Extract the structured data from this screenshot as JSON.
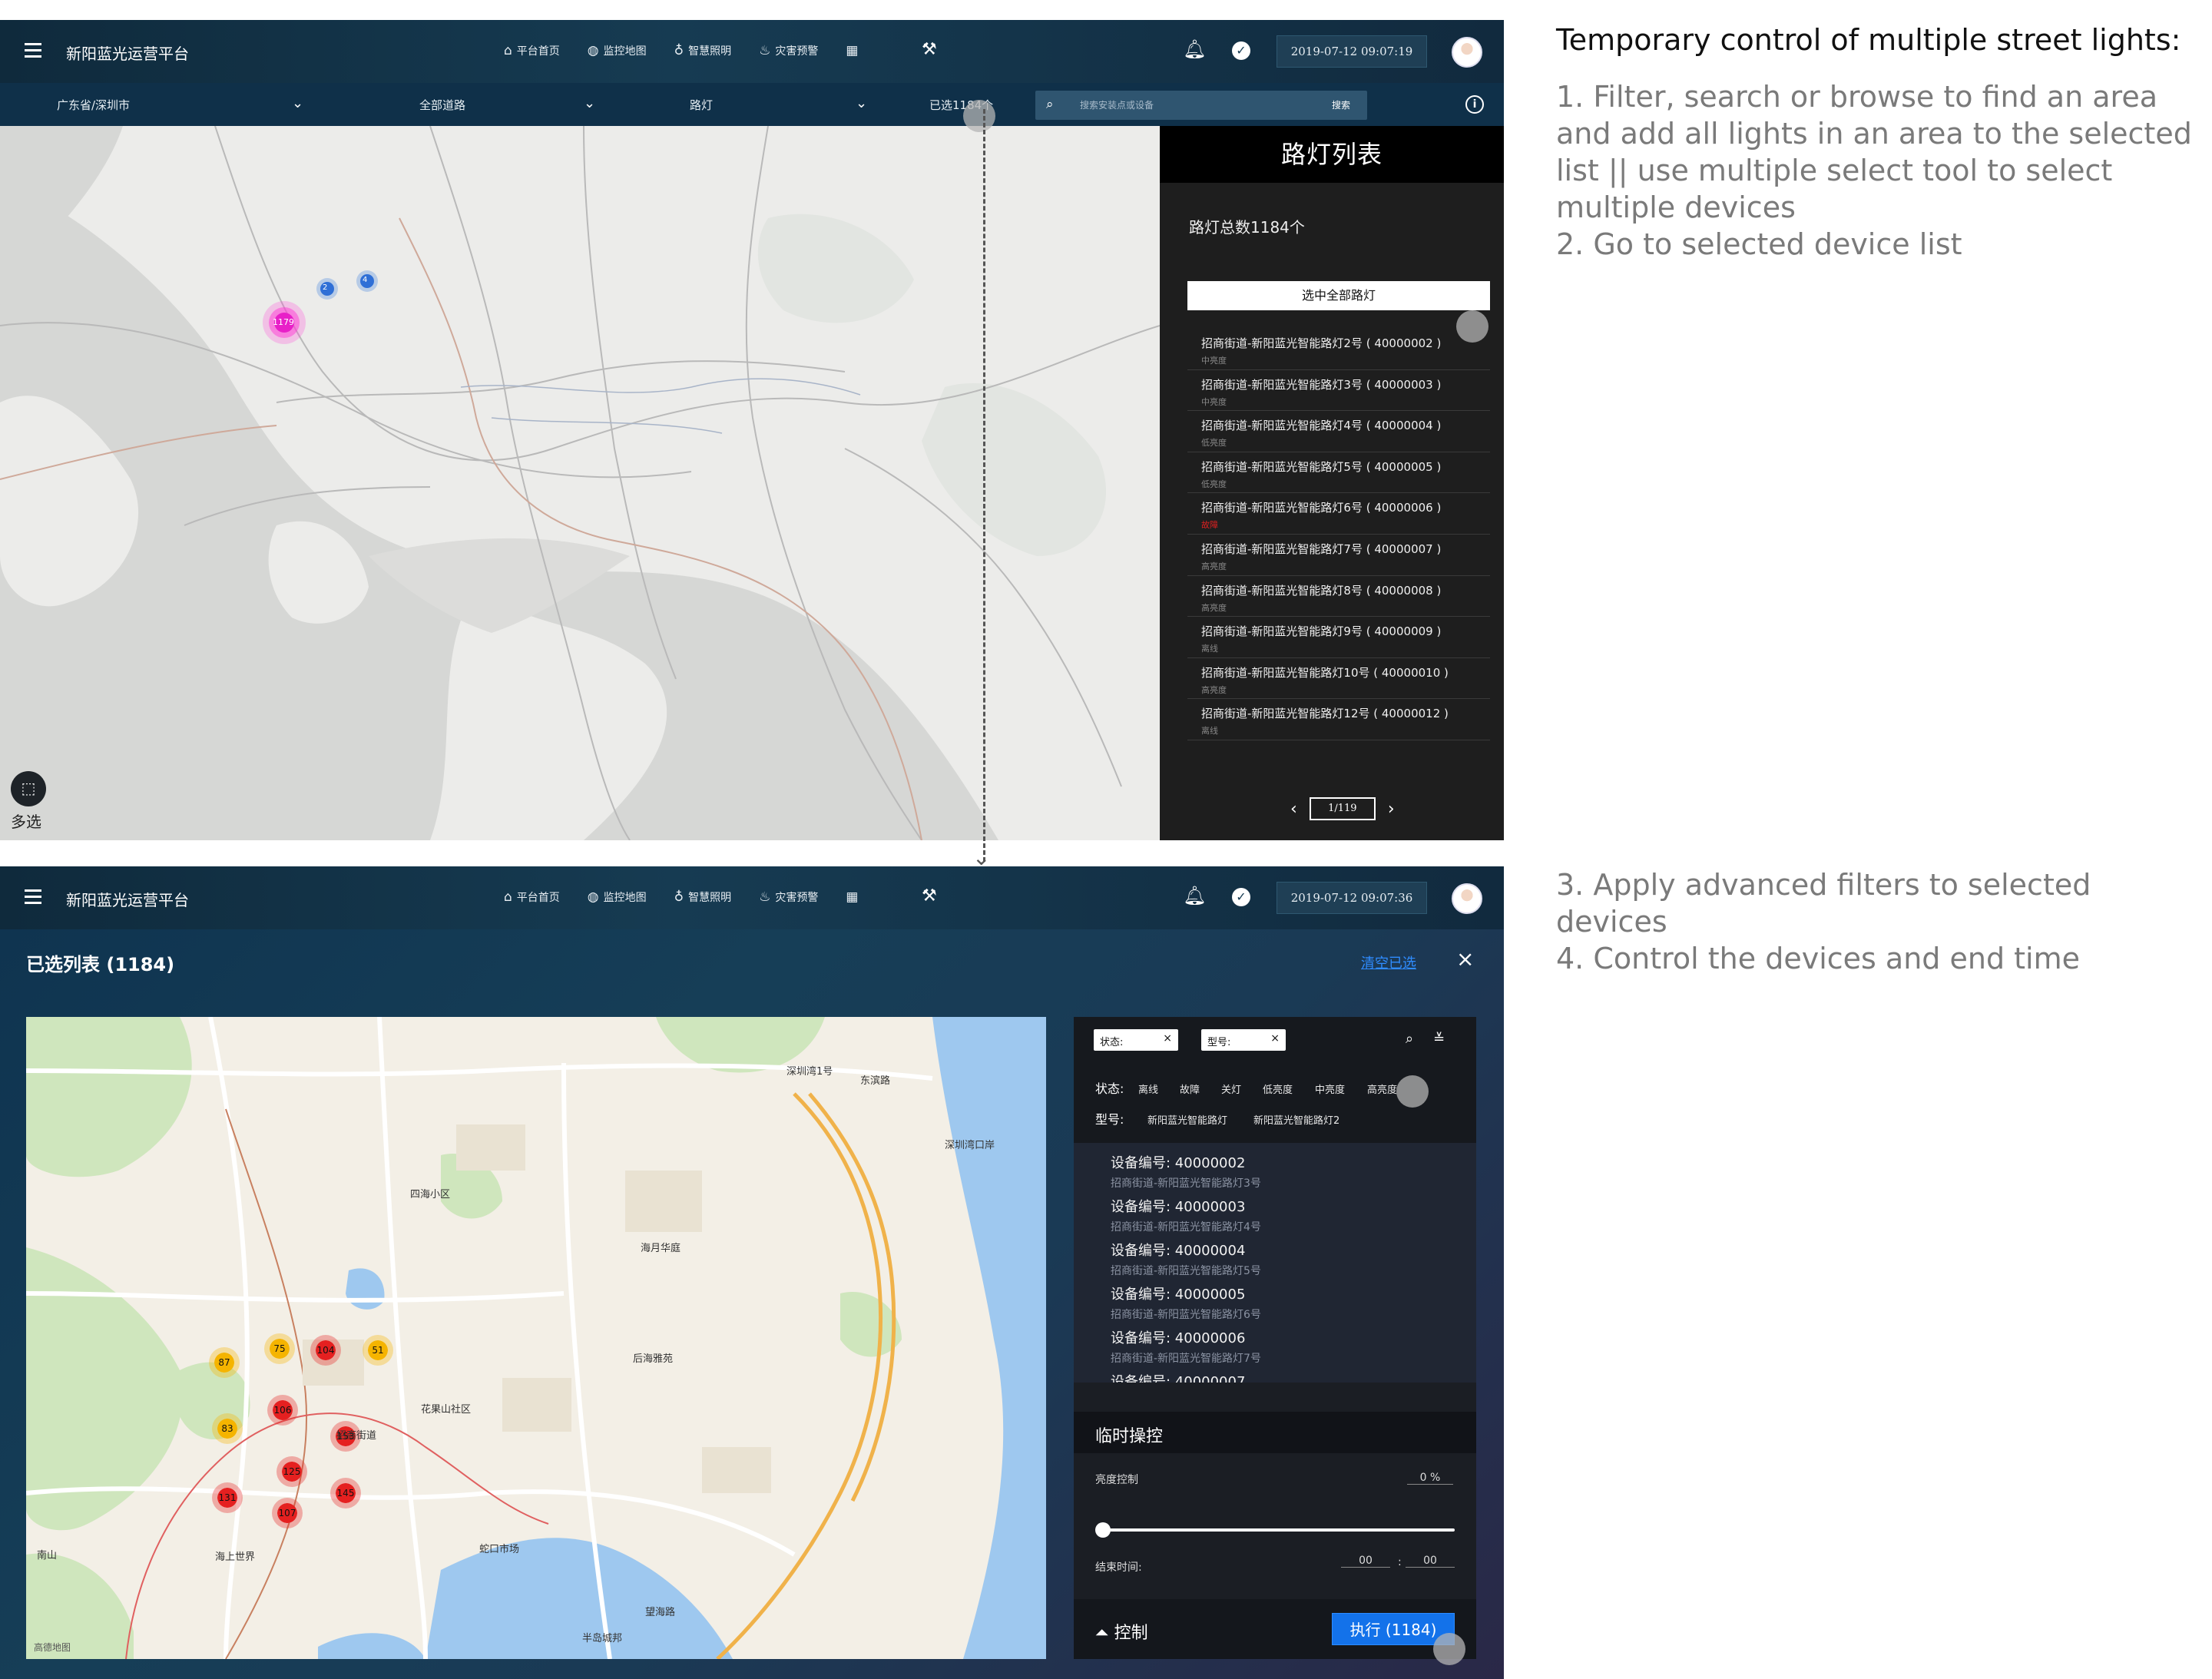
{
  "screen1": {
    "app_title": "新阳蓝光运营平台",
    "nav": [
      {
        "icon": "home-icon",
        "label": "平台首页"
      },
      {
        "icon": "globe-icon",
        "label": "监控地图"
      },
      {
        "icon": "bulb-icon",
        "label": "智慧照明"
      },
      {
        "icon": "alert-icon",
        "label": "灾害预警"
      }
    ],
    "datetime": "2019-07-12 09:07:19",
    "filter": {
      "region": "广东省/深圳市",
      "road": "全部道路",
      "device_type": "路灯",
      "selected": "已选1184个",
      "search_placeholder": "搜索安装点或设备",
      "search_button": "搜索"
    },
    "map": {
      "clusters": [
        "2",
        "4",
        "1179"
      ],
      "multi_select_label": "多选"
    },
    "side_list": {
      "title": "路灯列表",
      "total": "路灯总数1184个",
      "select_all_button": "选中全部路灯",
      "items": [
        {
          "name": "招商街道-新阳蓝光智能路灯2号 ( 40000002 )",
          "status": "中亮度"
        },
        {
          "name": "招商街道-新阳蓝光智能路灯3号 ( 40000003 )",
          "status": "中亮度"
        },
        {
          "name": "招商街道-新阳蓝光智能路灯4号 ( 40000004 )",
          "status": "低亮度"
        },
        {
          "name": "招商街道-新阳蓝光智能路灯5号 ( 40000005 )",
          "status": "低亮度"
        },
        {
          "name": "招商街道-新阳蓝光智能路灯6号 ( 40000006 )",
          "status": "故障"
        },
        {
          "name": "招商街道-新阳蓝光智能路灯7号 ( 40000007 )",
          "status": "高亮度"
        },
        {
          "name": "招商街道-新阳蓝光智能路灯8号 ( 40000008 )",
          "status": "高亮度"
        },
        {
          "name": "招商街道-新阳蓝光智能路灯9号 ( 40000009 )",
          "status": "离线"
        },
        {
          "name": "招商街道-新阳蓝光智能路灯10号 ( 40000010 )",
          "status": "高亮度"
        },
        {
          "name": "招商街道-新阳蓝光智能路灯12号 ( 40000012 )",
          "status": "离线"
        }
      ],
      "pager": "1/119"
    }
  },
  "screen2": {
    "app_title": "新阳蓝光运营平台",
    "datetime": "2019-07-12 09:07:36",
    "page_title": "已选列表 (1184)",
    "clear_link": "清空已选",
    "map": {
      "clusters": [
        {
          "label": "87",
          "color": "#f5b400"
        },
        {
          "label": "75",
          "color": "#f5b400"
        },
        {
          "label": "104",
          "color": "#e52020"
        },
        {
          "label": "51",
          "color": "#f5b400"
        },
        {
          "label": "106",
          "color": "#e52020"
        },
        {
          "label": "83",
          "color": "#f5b400"
        },
        {
          "label": "153",
          "color": "#e52020"
        },
        {
          "label": "125",
          "color": "#e52020"
        },
        {
          "label": "131",
          "color": "#e52020"
        },
        {
          "label": "107",
          "color": "#e52020"
        },
        {
          "label": "145",
          "color": "#e52020"
        }
      ],
      "places": [
        "南山",
        "海上世界",
        "半岛城邦",
        "深圳湾1号",
        "蛇口市场",
        "花果山社区",
        "东滨路",
        "深圳湾口岸",
        "海月华庭",
        "招商街道",
        "后海雅苑",
        "四海小区",
        "望海路",
        "高德地图"
      ]
    },
    "filters": {
      "chip_status": "状态:",
      "chip_model": "型号:",
      "status_label": "状态:",
      "status_options": [
        "离线",
        "故障",
        "关灯",
        "低亮度",
        "中亮度",
        "高亮度"
      ],
      "model_label": "型号:",
      "model_options": [
        "新阳蓝光智能路灯",
        "新阳蓝光智能路灯2"
      ]
    },
    "devices": [
      {
        "code": "设备编号: 40000002",
        "name": "招商街道-新阳蓝光智能路灯3号"
      },
      {
        "code": "设备编号: 40000003",
        "name": "招商街道-新阳蓝光智能路灯4号"
      },
      {
        "code": "设备编号: 40000004",
        "name": "招商街道-新阳蓝光智能路灯5号"
      },
      {
        "code": "设备编号: 40000005",
        "name": "招商街道-新阳蓝光智能路灯6号"
      },
      {
        "code": "设备编号: 40000006",
        "name": "招商街道-新阳蓝光智能路灯7号"
      },
      {
        "code": "设备编号: 40000007",
        "name": ""
      }
    ],
    "control": {
      "title": "临时操控",
      "brightness_label": "亮度控制",
      "brightness_value": "0 %",
      "brightness_level": 0,
      "end_time_label": "结束时间:",
      "hour": "00",
      "minute": "00",
      "sep": ":",
      "toggle_label": "控制",
      "execute_button": "执行 (1184)"
    }
  },
  "annotations": {
    "heading": "Temporary control of multiple street lights:",
    "steps_top": [
      "1. Filter, search or browse to find an area and add all lights in an area to the selected list || use multiple select tool to select multiple devices",
      "2. Go to selected device list"
    ],
    "steps_bottom": [
      "3. Apply advanced filters to selected devices",
      "4. Control the devices and end time"
    ]
  }
}
